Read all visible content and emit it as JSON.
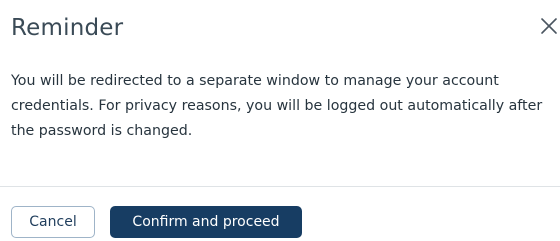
{
  "dialog": {
    "title": "Reminder",
    "message": "You will be redirected to a separate window to manage your account credentials. For privacy reasons, you will be logged out automatically after the password is changed.",
    "close_icon": "close-icon"
  },
  "actions": {
    "cancel_label": "Cancel",
    "confirm_label": "Confirm and proceed"
  },
  "colors": {
    "title": "#3a4a56",
    "text": "#27343e",
    "primary": "#173d63",
    "cancel_border": "#9fb4c8",
    "divider": "#dfe3e6"
  }
}
